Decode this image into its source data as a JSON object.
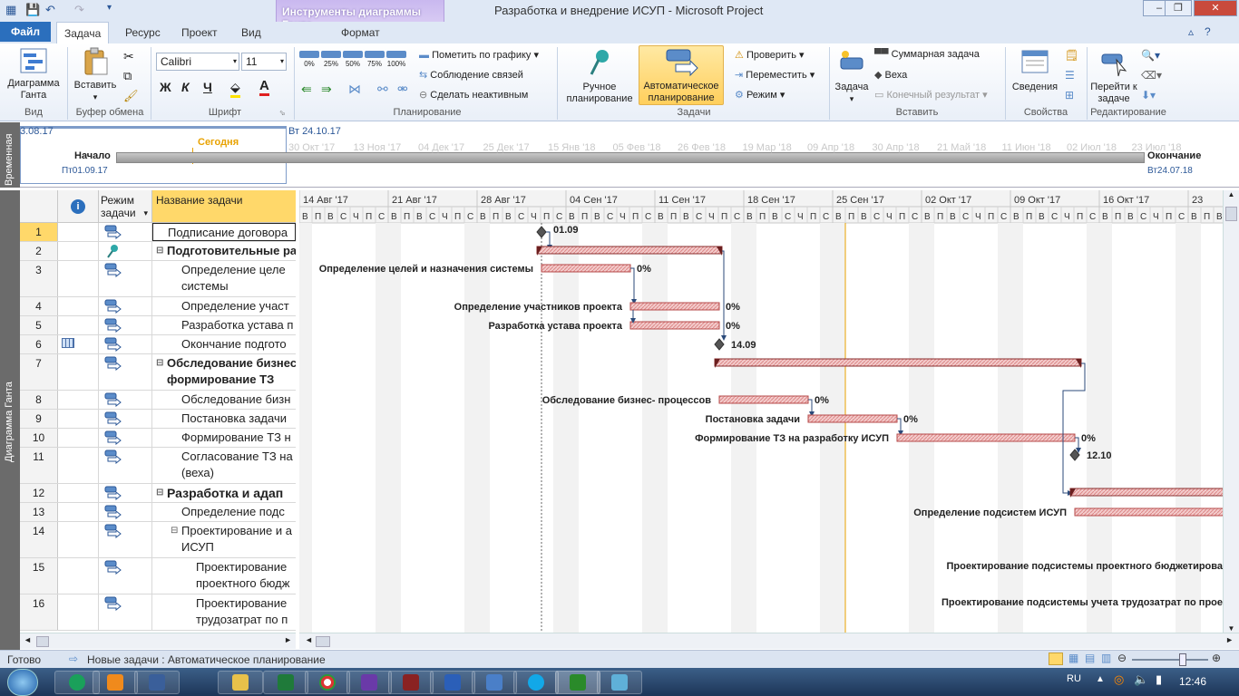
{
  "window": {
    "title": "Разработка и внедрение ИСУП - Microsoft Project",
    "context_title": "Инструменты диаграммы Ганта",
    "context_tab": "Формат"
  },
  "tabs": [
    {
      "label": "Файл"
    },
    {
      "label": "Задача"
    },
    {
      "label": "Ресурс"
    },
    {
      "label": "Проект"
    },
    {
      "label": "Вид"
    }
  ],
  "ribbon": {
    "view": {
      "gantt_label": "Диаграмма Ганта",
      "group": "Вид"
    },
    "clipboard": {
      "paste_label": "Вставить",
      "group": "Буфер обмена"
    },
    "font": {
      "font_name": "Calibri",
      "font_size": "11",
      "bold": "Ж",
      "italic": "К",
      "underline": "Ч",
      "group": "Шрифт"
    },
    "schedule": {
      "pct": [
        "0%",
        "25%",
        "50%",
        "75%",
        "100%"
      ],
      "mark_on_track": "Пометить по графику",
      "respect_links": "Соблюдение связей",
      "inactivate": "Сделать неактивным",
      "group": "Планирование"
    },
    "tasks": {
      "manual": "Ручное планирование",
      "auto": "Автоматическое планирование",
      "inspect": "Проверить",
      "move": "Переместить",
      "mode": "Режим",
      "group": "Задачи"
    },
    "insert": {
      "task": "Задача",
      "summary": "Суммарная задача",
      "milestone": "Веха",
      "deliverable": "Конечный результат",
      "group": "Вставить"
    },
    "properties": {
      "info": "Сведения",
      "group": "Свойства"
    },
    "editing": {
      "goto": "Перейти к задаче",
      "group": "Редактирование"
    }
  },
  "timeline": {
    "side_label": "Временная",
    "left_date": "3.08.17",
    "current_date": "Вт 24.10.17",
    "today_label": "Сегодня",
    "start_label": "Начало",
    "start_date": "Пт01.09.17",
    "end_label": "Окончание",
    "end_date": "Вт24.07.18",
    "ticks": [
      "30 Окт '17",
      "13 Ноя '17",
      "04 Дек '17",
      "25 Дек '17",
      "15 Янв '18",
      "05 Фев '18",
      "26 Фев '18",
      "19 Мар '18",
      "09 Апр '18",
      "30 Апр '18",
      "21 Май '18",
      "11 Июн '18",
      "02 Июл '18",
      "23 Июл '18"
    ]
  },
  "grid": {
    "side_label": "Диаграмма Ганта",
    "col_mode": "Режим задачи",
    "col_name": "Название задачи",
    "rows": [
      {
        "id": "1",
        "name": "Подписание договора",
        "indent": 0,
        "bold": false,
        "ind": "",
        "mode": "auto"
      },
      {
        "id": "2",
        "name": "Подготовительные ра",
        "indent": 0,
        "bold": true,
        "ind": "",
        "mode": "manual",
        "collapse": "⊟"
      },
      {
        "id": "3",
        "name": "Определение целе",
        "name2": "системы",
        "indent": 1,
        "bold": false,
        "ind": "",
        "mode": "auto"
      },
      {
        "id": "4",
        "name": "Определение участ",
        "indent": 1,
        "bold": false,
        "ind": "",
        "mode": "auto"
      },
      {
        "id": "5",
        "name": "Разработка устава п",
        "indent": 1,
        "bold": false,
        "ind": "",
        "mode": "auto"
      },
      {
        "id": "6",
        "name": "Окончание подгото",
        "indent": 1,
        "bold": false,
        "ind": "calendar",
        "mode": "auto"
      },
      {
        "id": "7",
        "name": "Обследование бизнес",
        "name2": "формирование ТЗ",
        "indent": 0,
        "bold": true,
        "ind": "",
        "mode": "auto",
        "collapse": "⊟"
      },
      {
        "id": "8",
        "name": "Обследование бизн",
        "indent": 1,
        "bold": false,
        "ind": "",
        "mode": "auto"
      },
      {
        "id": "9",
        "name": "Постановка задачи",
        "indent": 1,
        "bold": false,
        "ind": "",
        "mode": "auto"
      },
      {
        "id": "10",
        "name": "Формирование ТЗ н",
        "indent": 1,
        "bold": false,
        "ind": "",
        "mode": "auto"
      },
      {
        "id": "11",
        "name": "Согласование ТЗ на",
        "name2": "(веха)",
        "indent": 1,
        "bold": false,
        "ind": "",
        "mode": "auto"
      },
      {
        "id": "12",
        "name": "Разработка и адап",
        "indent": 0,
        "bold": true,
        "big": true,
        "ind": "",
        "mode": "auto",
        "collapse": "⊟"
      },
      {
        "id": "13",
        "name": "Определение подс",
        "indent": 1,
        "bold": false,
        "ind": "",
        "mode": "auto"
      },
      {
        "id": "14",
        "name": "Проектирование и а",
        "name2": "ИСУП",
        "indent": 1,
        "bold": false,
        "ind": "",
        "mode": "auto",
        "collapse": "⊟"
      },
      {
        "id": "15",
        "name": "Проектирование",
        "name2": "проектного бюдж",
        "indent": 2,
        "bold": false,
        "ind": "",
        "mode": "auto"
      },
      {
        "id": "16",
        "name": "Проектирование",
        "name2": "трудозатрат по п",
        "indent": 2,
        "bold": false,
        "ind": "",
        "mode": "auto"
      }
    ]
  },
  "chart": {
    "weeks": [
      "14 Авг '17",
      "21 Авг '17",
      "28 Авг '17",
      "04 Сен '17",
      "11 Сен '17",
      "18 Сен '17",
      "25 Сен '17",
      "02 Окт '17",
      "09 Окт '17",
      "16 Окт '17",
      "23"
    ],
    "days": [
      "В",
      "П",
      "В",
      "С",
      "Ч",
      "П",
      "С"
    ],
    "milestone1": "01.09",
    "milestone6": "14.09",
    "milestone11": "12.10",
    "labels": {
      "r3": "Определение целей и назначения системы",
      "r4": "Определение участников проекта",
      "r5": "Разработка устава проекта",
      "r8": "Обследование бизнес- процессов",
      "r9": "Постановка задачи",
      "r10": "Формирование ТЗ на разработку ИСУП",
      "r13": "Определение подсистем ИСУП",
      "r15": "Проектирование подсистемы проектного бюджетирова",
      "r16": "Проектирование подсистемы учета трудозатрат по прое"
    },
    "pct": "0%"
  },
  "status": {
    "ready": "Готово",
    "new_tasks": "Новые задачи : Автоматическое планирование"
  },
  "taskbar": {
    "lang": "RU",
    "time": "12:46"
  },
  "colors": {
    "bar_fill": "#f2c7c7",
    "bar_border": "#b54848",
    "accent": "#2b6fbd"
  }
}
